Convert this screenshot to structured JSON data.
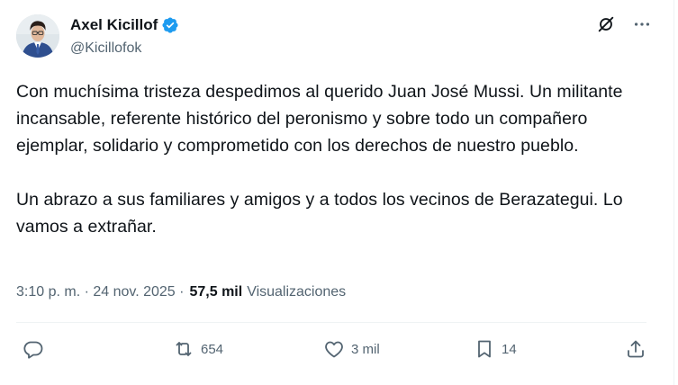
{
  "author": {
    "display_name": "Axel Kicillof",
    "handle": "@Kicillofok",
    "verified": true,
    "verified_color": "#1d9bf0"
  },
  "header_icons": [
    "grok-icon",
    "more-options-icon"
  ],
  "post": {
    "text": "Con muchísima tristeza despedimos al querido Juan José Mussi. Un militante incansable, referente histórico del peronismo y sobre todo un compañero ejemplar, solidario y comprometido con los derechos de nuestro pueblo.\n\nUn abrazo a sus familiares y amigos y a todos los vecinos de Berazategui. Lo vamos a extrañar.",
    "time": "3:10 p. m. · 24 nov. 2025 ·",
    "views_count": "57,5 mil",
    "views_label": "Visualizaciones"
  },
  "actions": {
    "reply_count": "",
    "repost_count": "654",
    "like_count": "3 mil",
    "bookmark_count": "14"
  },
  "colors": {
    "text": "#0f1419",
    "secondary": "#536471",
    "border": "#eff3f4"
  }
}
